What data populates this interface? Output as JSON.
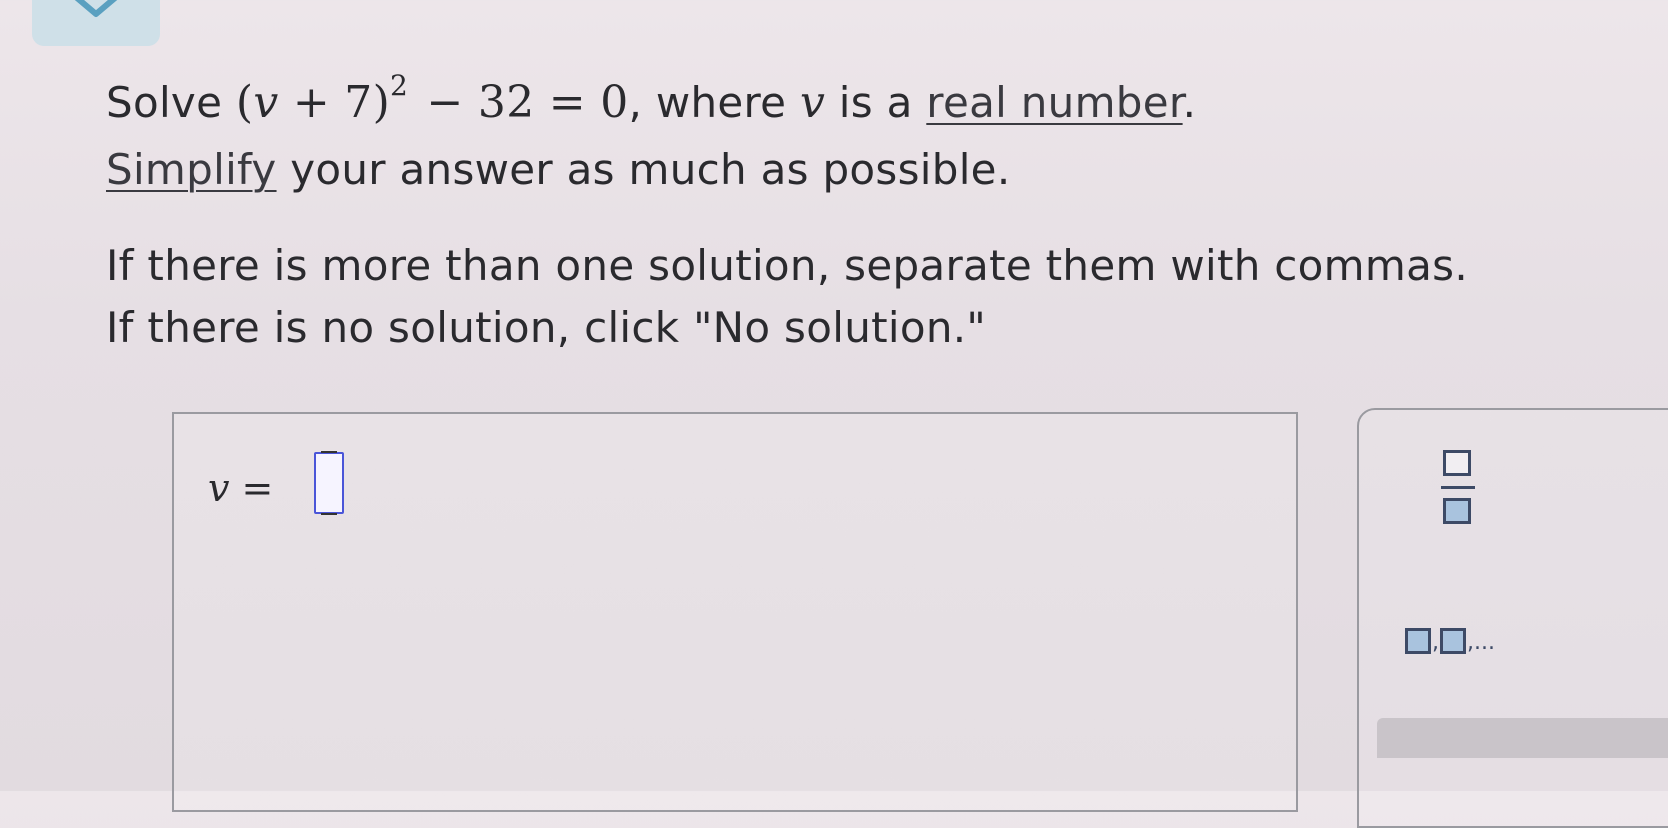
{
  "problem": {
    "solve_word": "Solve",
    "eq_open": "(",
    "eq_var": "v",
    "eq_plus": " + 7)",
    "eq_exp": "2",
    "eq_rest": " − 32 = 0",
    "where_text": ", where ",
    "where_var": "v",
    "is_a_text": " is a ",
    "real_number_link": "real number",
    "period": ".",
    "simplify_link": "Simplify",
    "simplify_rest": " your answer as much as possible.",
    "instruction_1": "If there is more than one solution, separate them with commas.",
    "instruction_2": "If there is no solution, click \"No solution.\""
  },
  "answer": {
    "var": "v",
    "equals": " =",
    "value": ""
  },
  "toolbox": {
    "list_comma_1": ",",
    "list_comma_2": ",...",
    "fraction_tool": "fraction-icon",
    "list_tool": "list-icon"
  },
  "colors": {
    "accent_input": "#4a55d8",
    "tool_icon": "#3d4a66",
    "tool_fill": "#a9c3de",
    "tab": "#cfe0e8"
  }
}
